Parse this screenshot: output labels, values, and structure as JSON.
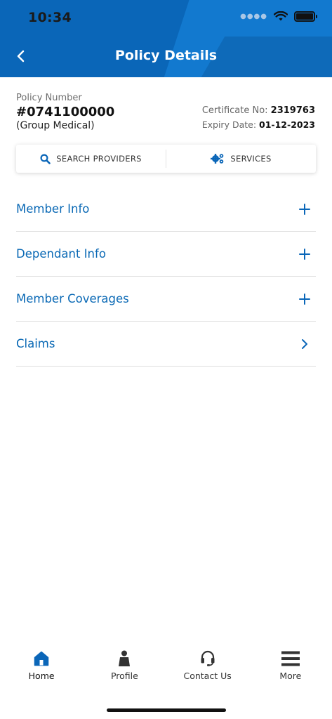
{
  "status_bar": {
    "time": "10:34",
    "signal_icon": "cellular-dots-icon",
    "wifi_icon": "wifi-icon",
    "battery_icon": "battery-icon"
  },
  "header": {
    "title": "Policy Details",
    "back_icon": "chevron-left-icon"
  },
  "policy": {
    "number_label": "Policy Number",
    "number": "#0741100000",
    "type": "(Group Medical)",
    "certificate_label": "Certificate No:",
    "certificate_value": "2319763",
    "expiry_label": "Expiry Date:",
    "expiry_value": "01-12-2023"
  },
  "actions": [
    {
      "label": "SEARCH PROVIDERS",
      "icon": "search-icon"
    },
    {
      "label": "SERVICES",
      "icon": "gears-icon"
    }
  ],
  "menu": [
    {
      "label": "Member Info",
      "icon": "plus-icon"
    },
    {
      "label": "Dependant Info",
      "icon": "plus-icon"
    },
    {
      "label": "Member Coverages",
      "icon": "plus-icon"
    },
    {
      "label": "Claims",
      "icon": "chevron-right-icon"
    }
  ],
  "bottom_nav": [
    {
      "label": "Home",
      "icon": "home-icon",
      "active": true
    },
    {
      "label": "Profile",
      "icon": "person-icon",
      "active": false
    },
    {
      "label": "Contact Us",
      "icon": "headset-icon",
      "active": false
    },
    {
      "label": "More",
      "icon": "hamburger-menu-icon",
      "active": false
    }
  ],
  "colors": {
    "primary": "#0a66b8",
    "link": "#0a69b5",
    "active_nav": "#0a66b8",
    "inactive_nav": "#333333"
  }
}
